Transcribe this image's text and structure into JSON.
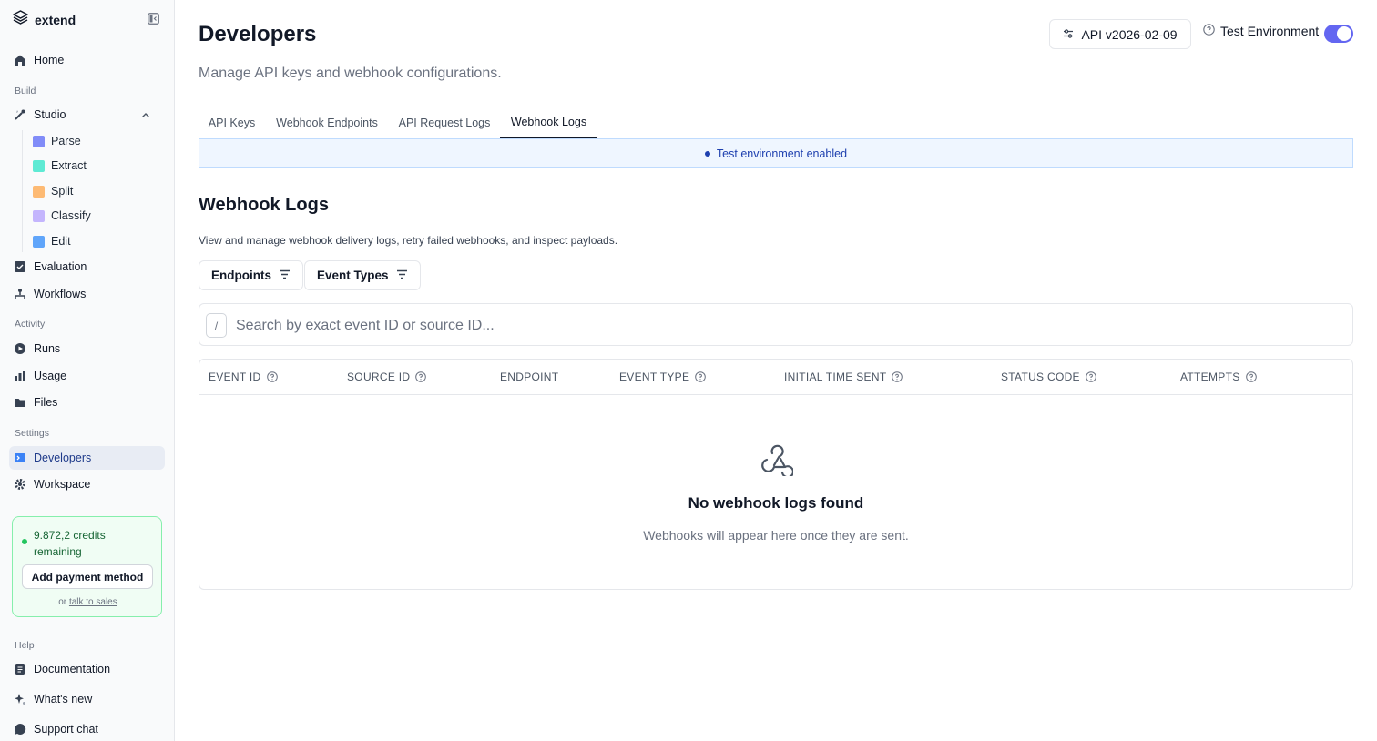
{
  "brand": {
    "name": "extend"
  },
  "sidebar": {
    "home": "Home",
    "build_label": "Build",
    "studio": "Studio",
    "studio_items": [
      "Parse",
      "Extract",
      "Split",
      "Classify",
      "Edit"
    ],
    "evaluation": "Evaluation",
    "workflows": "Workflows",
    "activity_label": "Activity",
    "runs": "Runs",
    "usage": "Usage",
    "files": "Files",
    "settings_label": "Settings",
    "developers": "Developers",
    "workspace": "Workspace",
    "credits": {
      "text": "9.872,2 credits remaining",
      "button": "Add payment method",
      "or": "or",
      "link": "talk to sales"
    },
    "help_label": "Help",
    "documentation": "Documentation",
    "whats_new": "What's new",
    "support_chat": "Support chat"
  },
  "header": {
    "title": "Developers",
    "subtitle": "Manage API keys and webhook configurations.",
    "api_version": "API v2026-02-09",
    "env_label": "Test Environment",
    "env_enabled": true
  },
  "tabs": [
    {
      "label": "API Keys",
      "active": false
    },
    {
      "label": "Webhook Endpoints",
      "active": false
    },
    {
      "label": "API Request Logs",
      "active": false
    },
    {
      "label": "Webhook Logs",
      "active": true
    }
  ],
  "banner": {
    "text": "Test environment enabled"
  },
  "section": {
    "title": "Webhook Logs",
    "description": "View and manage webhook delivery logs, retry failed webhooks, and inspect payloads."
  },
  "filters": {
    "endpoints": "Endpoints",
    "event_types": "Event Types"
  },
  "search": {
    "shortcut": "/",
    "placeholder": "Search by exact event ID or source ID...",
    "value": ""
  },
  "table": {
    "columns": [
      "EVENT ID",
      "SOURCE ID",
      "ENDPOINT",
      "EVENT TYPE",
      "INITIAL TIME SENT",
      "STATUS CODE",
      "ATTEMPTS"
    ],
    "rows": []
  },
  "empty": {
    "title": "No webhook logs found",
    "subtitle": "Webhooks will appear here once they are sent."
  },
  "colors": {
    "accent": "#6366f1",
    "active_nav": "#1e3a8a",
    "credits_bg": "#f0fdf4",
    "banner_text": "#1e40af"
  }
}
